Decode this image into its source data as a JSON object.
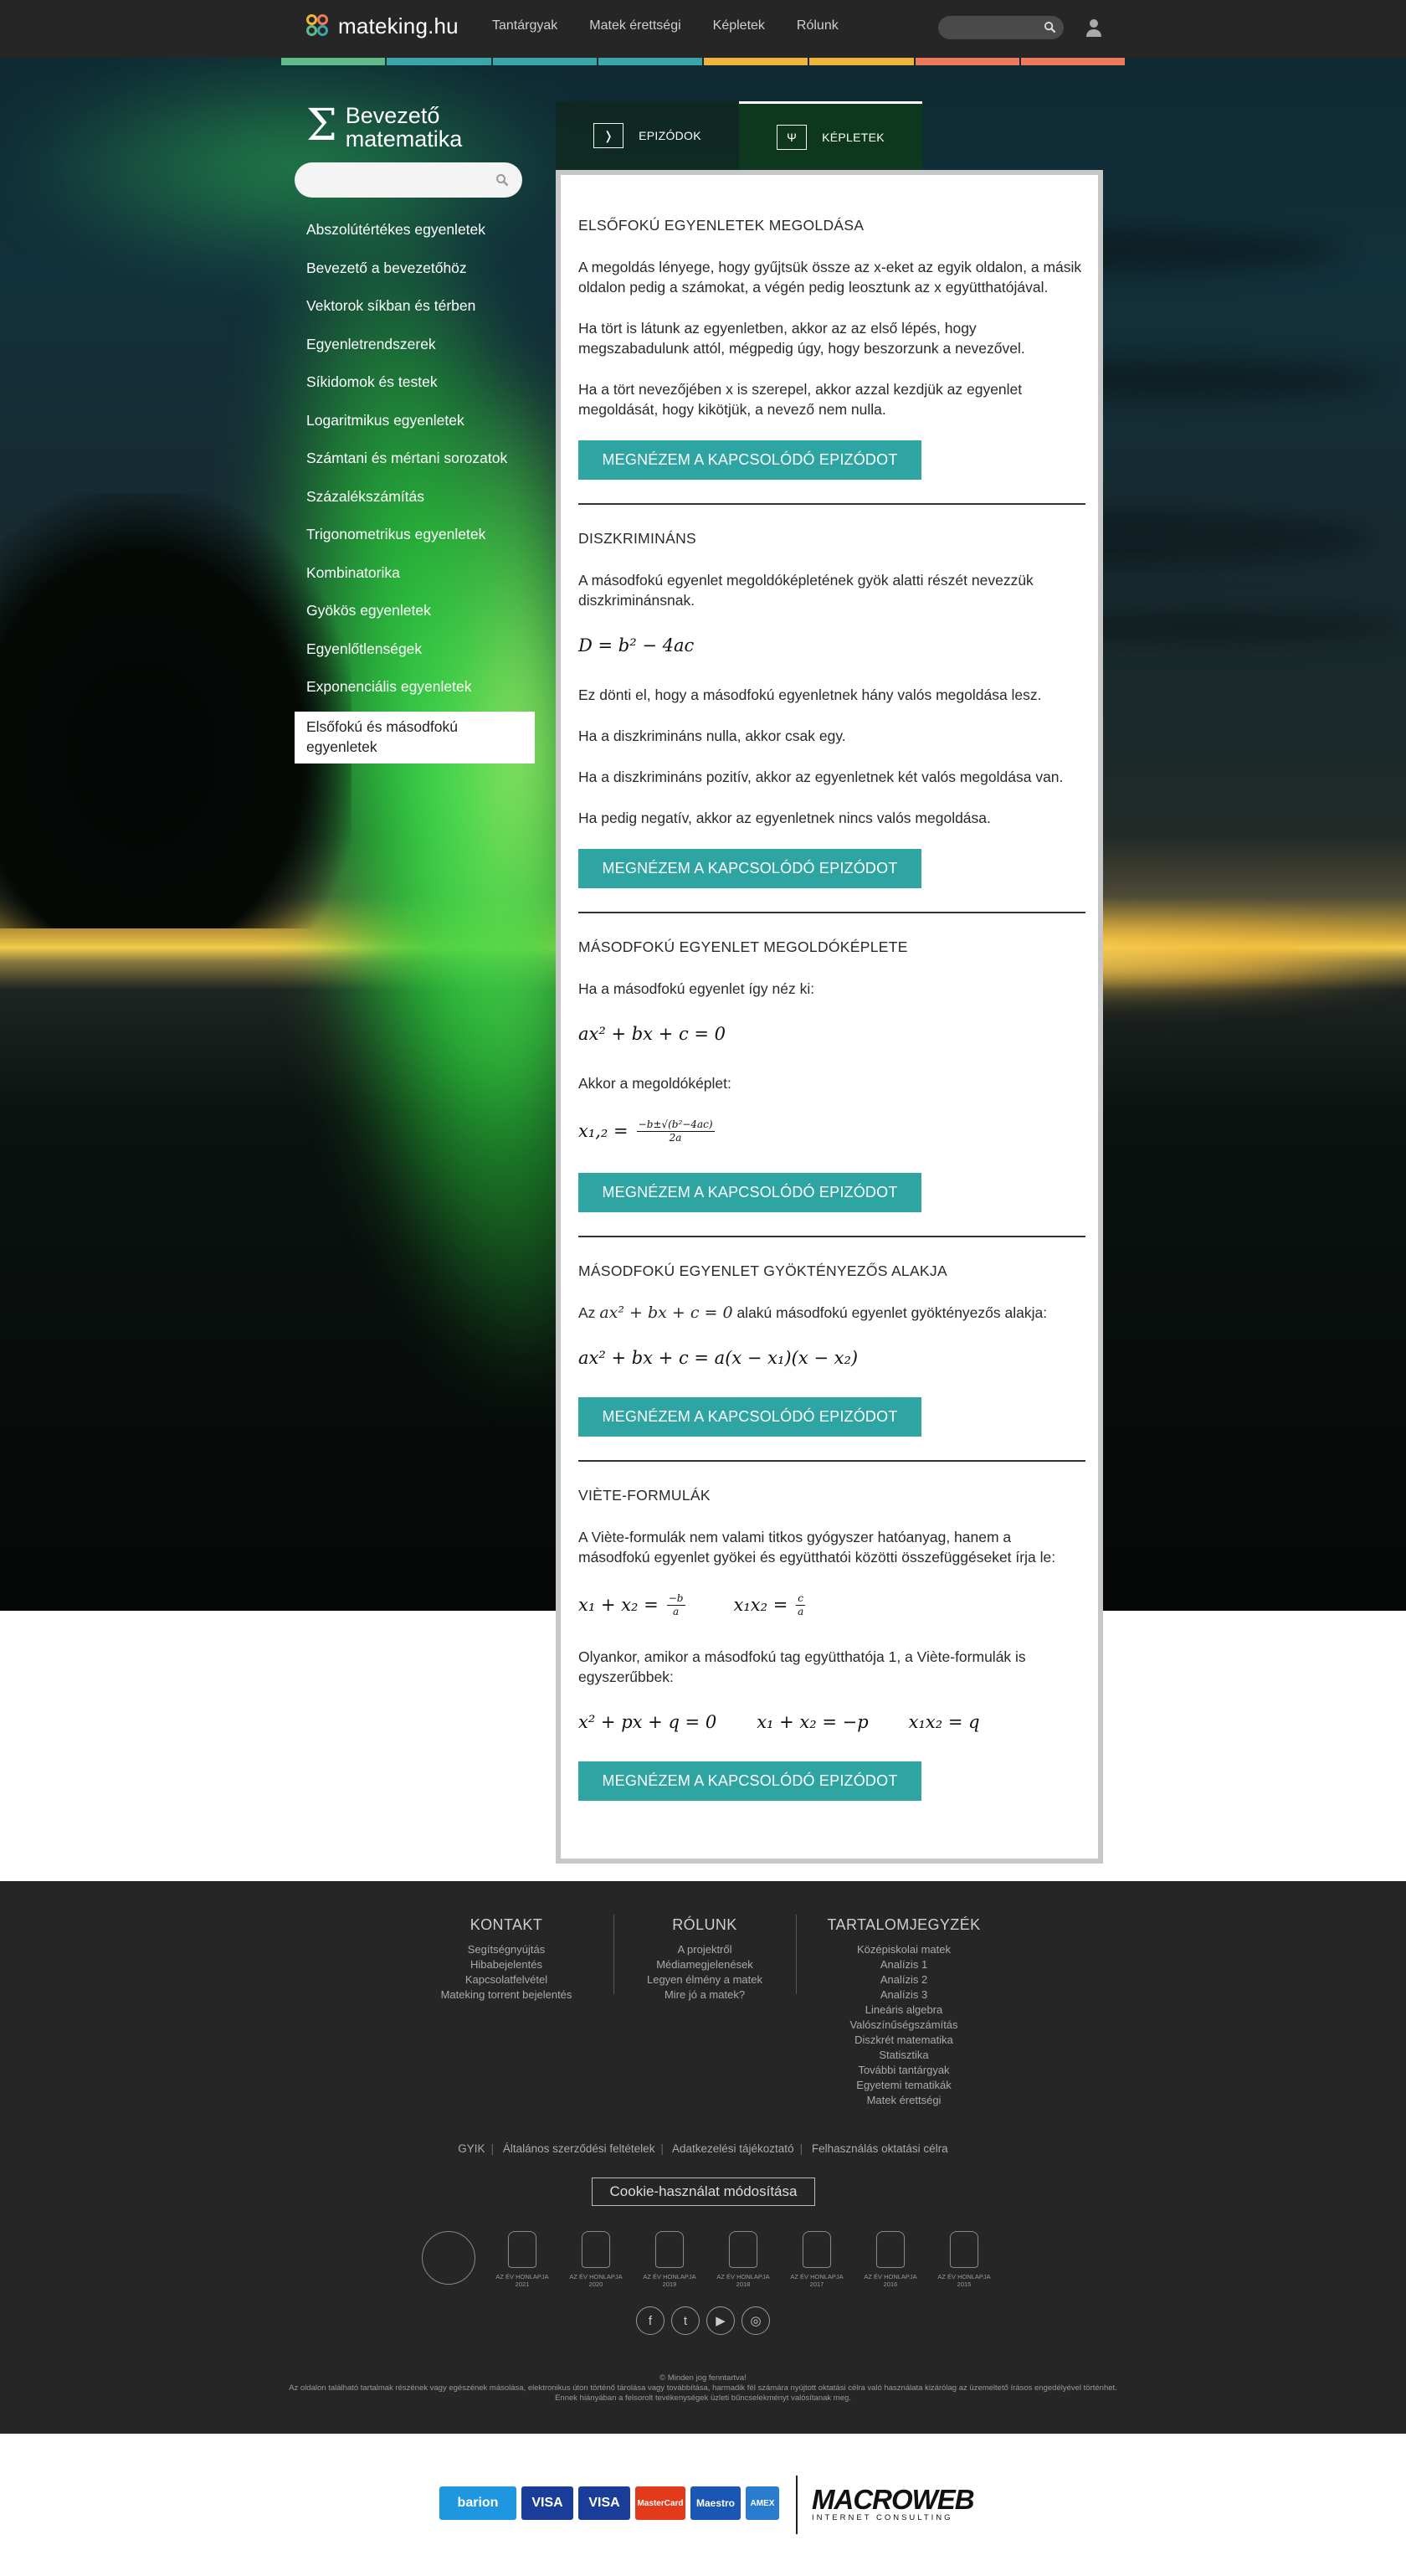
{
  "header": {
    "logo_text": "mateking.hu",
    "nav": [
      "Tantárgyak",
      "Matek érettségi",
      "Képletek",
      "Rólunk"
    ],
    "colorbar": [
      "#5fbb89",
      "#3aa6ab",
      "#3aa6ab",
      "#3aa6ab",
      "#f0b439",
      "#f0b439",
      "#ef7a5b",
      "#ef7a5b"
    ]
  },
  "sidebar": {
    "title_line1": "Bevezető",
    "title_line2": "matematika",
    "items": [
      {
        "label": "Abszolútértékes egyenletek"
      },
      {
        "label": "Bevezető a bevezetőhöz"
      },
      {
        "label": "Vektorok síkban és térben"
      },
      {
        "label": "Egyenletrendszerek"
      },
      {
        "label": "Síkidomok és testek"
      },
      {
        "label": "Logaritmikus egyenletek"
      },
      {
        "label": "Számtani és mértani sorozatok"
      },
      {
        "label": "Százalékszámítás"
      },
      {
        "label": "Trigonometrikus egyenletek"
      },
      {
        "label": "Kombinatorika"
      },
      {
        "label": "Gyökös egyenletek"
      },
      {
        "label": "Egyenlőtlenségek"
      },
      {
        "label": "Exponenciális egyenletek"
      },
      {
        "label": "Elsőfokú és másodfokú egyenletek"
      }
    ]
  },
  "tabs": {
    "episodes": {
      "icon": "❭",
      "label": "EPIZÓDOK"
    },
    "formulas": {
      "icon": "Ψ",
      "label": "KÉPLETEK"
    }
  },
  "button_label": "MEGNÉZEM A KAPCSOLÓDÓ EPIZÓDOT",
  "sections": {
    "s1": {
      "title": "ELSŐFOKÚ EGYENLETEK MEGOLDÁSA",
      "p1": "A megoldás lényege, hogy gyűjtsük össze az x-eket az egyik oldalon, a másik oldalon pedig a számokat, a végén pedig leosztunk az x együtthatójával.",
      "p2": "Ha tört is látunk az egyenletben, akkor az az első lépés, hogy megszabadulunk attól, mégpedig úgy, hogy beszorzunk a nevezővel.",
      "p3": "Ha a tört nevezőjében x is szerepel, akkor azzal kezdjük az egyenlet megoldását, hogy kikötjük, a nevező nem nulla."
    },
    "s2": {
      "title": "DISZKRIMINÁNS",
      "p1": "A másodfokú egyenlet megoldóképletének gyök alatti részét nevezzük diszkriminánsnak.",
      "formula": "D = b² − 4ac",
      "p2": "Ez dönti el, hogy a másodfokú egyenletnek hány valós megoldása lesz.",
      "p3": "Ha a diszkrimináns nulla, akkor csak egy.",
      "p4": "Ha a diszkrimináns pozitív, akkor az egyenletnek két valós megoldása van.",
      "p5": "Ha pedig negatív, akkor az egyenletnek nincs valós megoldása."
    },
    "s3": {
      "title": "MÁSODFOKÚ EGYENLET MEGOLDÓKÉPLETE",
      "p1": "Ha a másodfokú egyenlet így néz ki:",
      "formula1": "ax² + bx + c = 0",
      "p2": "Akkor a megoldóképlet:",
      "formula2_lhs": "x₁,₂ =",
      "formula2_num": "−b±√(b²−4ac)",
      "formula2_den": "2a"
    },
    "s4": {
      "title": "MÁSODFOKÚ EGYENLET GYÖKTÉNYEZŐS ALAKJA",
      "p1_before": "Az",
      "p1_formula": "ax² + bx + c = 0",
      "p1_after": "alakú másodfokú egyenlet gyöktényezős alakja:",
      "formula": "ax² + bx + c = a(x − x₁)(x − x₂)"
    },
    "s5": {
      "title": "VIÈTE-FORMULÁK",
      "p1": "A Viète-formulák nem valami titkos gyógyszer hatóanyag, hanem a másodfokú egyenlet gyökei és együtthatói közötti összefüggéseket írja le:",
      "f1_lhs": "x₁ + x₂ =",
      "f1_num": "−b",
      "f1_den": "a",
      "f2_lhs": "x₁x₂ =",
      "f2_num": "c",
      "f2_den": "a",
      "p2": "Olyankor, amikor a másodfokú tag együtthatója 1, a Viète-formulák is egyszerűbbek:",
      "g1": "x² + px + q = 0",
      "g2": "x₁ + x₂ = −p",
      "g3": "x₁x₂ = q"
    }
  },
  "footer": {
    "kontakt": {
      "title": "KONTAKT",
      "items": [
        "Segítségnyújtás",
        "Hibabejelentés",
        "Kapcsolatfelvétel",
        "Mateking torrent bejelentés"
      ]
    },
    "rolunk": {
      "title": "RÓLUNK",
      "items": [
        "A projektről",
        "Médiamegjelenések",
        "Legyen élmény a matek",
        "Mire jó a matek?"
      ]
    },
    "toc": {
      "title": "TARTALOMJEGYZÉK",
      "items": [
        "Középiskolai matek",
        "Analízis 1",
        "Analízis 2",
        "Analízis 3",
        "Lineáris algebra",
        "Valószínűségszámítás",
        "Diszkrét matematika",
        "Statisztika",
        "További tantárgyak",
        "Egyetemi tematikák",
        "Matek érettségi"
      ]
    },
    "links": [
      "GYIK",
      "Általános szerződési feltételek",
      "Adatkezelési tájékoztató",
      "Felhasználás oktatási célra"
    ],
    "cookie_label": "Cookie-használat módosítása",
    "awards": [
      {
        "label": "Az Év Honlapja",
        "year": "2015",
        "round": true
      },
      {
        "label": "AZ ÉV HONLAPJA",
        "year": "2021"
      },
      {
        "label": "AZ ÉV HONLAPJA",
        "year": "2020"
      },
      {
        "label": "AZ ÉV HONLAPJA",
        "year": "2019"
      },
      {
        "label": "AZ ÉV HONLAPJA",
        "year": "2018"
      },
      {
        "label": "AZ ÉV HONLAPJA",
        "year": "2017"
      },
      {
        "label": "AZ ÉV HONLAPJA",
        "year": "2016"
      },
      {
        "label": "AZ ÉV HONLAPJA",
        "year": "2015"
      }
    ],
    "social": [
      "f",
      "t",
      "▶",
      "◎"
    ],
    "copyright": "© Minden jog fenntartva!",
    "legal": "Az oldalon található tartalmak részének vagy egészének másolása, elektronikus úton történő tárolása vagy továbbítása, harmadik fél számára nyújtott oktatási célra való használata kizárólag az üzemeltető írásos engedélyével történhet. Ennek hiányában a felsorolt tevékenységek üzleti bűncselekményt valósítanak meg."
  },
  "payments": {
    "logos": [
      {
        "label": "barion",
        "color": "#1e96e0"
      },
      {
        "label": "VISA",
        "color": "#1a3d9a"
      },
      {
        "label": "VISA",
        "color": "#1a3d9a"
      },
      {
        "label": "MasterCard",
        "color": "#e23a1a"
      },
      {
        "label": "Maestro",
        "color": "#1a56b4"
      },
      {
        "label": "AMEX",
        "color": "#2a7ccf"
      }
    ],
    "brand": "MACROWEB",
    "brand_sub": "INTERNET CONSULTING"
  }
}
